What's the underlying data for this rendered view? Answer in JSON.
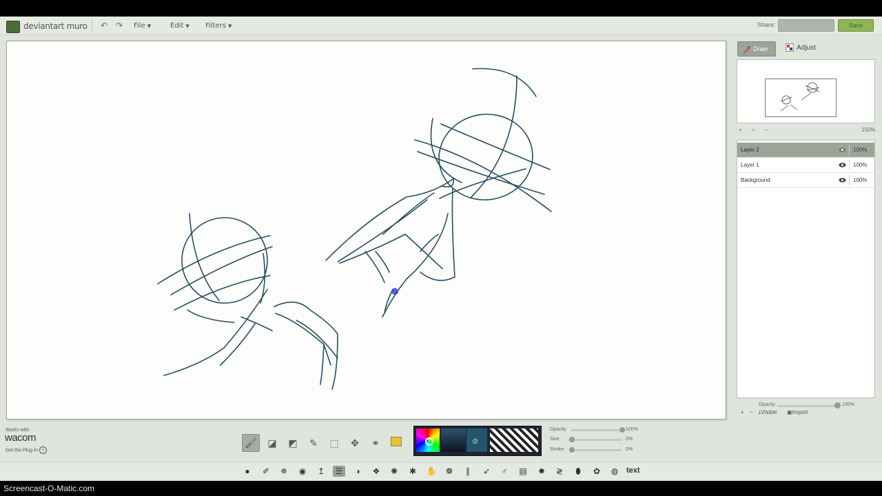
{
  "app": {
    "title": "deviantart muro"
  },
  "menu": {
    "undo_icon": "undo-icon",
    "redo_icon": "redo-icon",
    "items": [
      {
        "label": "File"
      },
      {
        "label": "Edit"
      },
      {
        "label": "Filters"
      }
    ]
  },
  "share": {
    "label": "Share:",
    "save_label": "Save"
  },
  "right_panel": {
    "tabs": [
      {
        "label": "Draw",
        "icon": "brush-icon",
        "active": true
      },
      {
        "label": "Adjust",
        "icon": "adjust-icon",
        "active": false
      }
    ],
    "zoom": {
      "plus": "+",
      "minus": "−",
      "value": "150%"
    },
    "layers": [
      {
        "name": "Layer 2",
        "opacity": "100%",
        "selected": true
      },
      {
        "name": "Layer 1",
        "opacity": "100%",
        "selected": false
      },
      {
        "name": "Background",
        "opacity": "100%",
        "selected": false
      }
    ],
    "layer_opacity": {
      "label": "Opacity",
      "value": "100%",
      "level": 1.0
    },
    "layer_footer": {
      "add": "+",
      "remove": "−",
      "visible": "Visible",
      "import": "Import"
    }
  },
  "wacom": {
    "works_with": "Works with",
    "logo": "wacom",
    "plug": "Get the Plug-In"
  },
  "tools": [
    {
      "icon": "brush-icon",
      "active": true
    },
    {
      "icon": "eraser-icon",
      "active": false
    },
    {
      "icon": "fill-eraser-icon",
      "active": false
    },
    {
      "icon": "eyedropper-icon",
      "active": false
    },
    {
      "icon": "select-rect-icon",
      "active": false
    },
    {
      "icon": "move-icon",
      "active": false
    },
    {
      "icon": "lasso-icon",
      "active": false
    },
    {
      "icon": "stamp-icon",
      "active": false
    }
  ],
  "color": {
    "current": "#23566a",
    "stroke": "#244f5e"
  },
  "brush_sliders": [
    {
      "label": "Opacity",
      "value": "100%",
      "level": 1.0
    },
    {
      "label": "Size",
      "value": "0%",
      "level": 0.0
    },
    {
      "label": "Stroke",
      "value": "0%",
      "level": 0.0
    }
  ],
  "brushes": [
    {
      "icon": "dot-brush-icon"
    },
    {
      "icon": "pencil-brush-icon"
    },
    {
      "icon": "grid-brush-icon"
    },
    {
      "icon": "circle-brush-icon"
    },
    {
      "icon": "curve-brush-icon"
    },
    {
      "icon": "lines-brush-icon",
      "active": true
    },
    {
      "icon": "half-circle-brush-icon"
    },
    {
      "icon": "paw-brush-icon"
    },
    {
      "icon": "spiral-brush-icon"
    },
    {
      "icon": "star-brush-icon"
    },
    {
      "icon": "hand-brush-icon"
    },
    {
      "icon": "swirl-brush-icon"
    },
    {
      "icon": "bars-brush-icon"
    },
    {
      "icon": "feather-brush-icon"
    },
    {
      "icon": "stick-brush-icon"
    },
    {
      "icon": "stripes-brush-icon"
    },
    {
      "icon": "splat-brush-icon"
    },
    {
      "icon": "wave-brush-icon"
    },
    {
      "icon": "drop-brush-icon"
    },
    {
      "icon": "blob-brush-icon"
    },
    {
      "icon": "sphere-brush-icon"
    }
  ],
  "brush_text": "text",
  "footer": {
    "watermark": "Screencast-O-Matic.com"
  }
}
